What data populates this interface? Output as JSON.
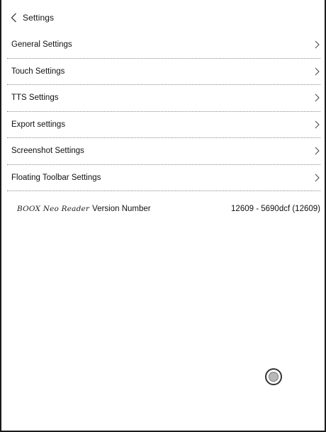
{
  "header": {
    "back_icon": "chevron-left-icon",
    "title": "Settings"
  },
  "settings": {
    "items": [
      {
        "label": "General Settings",
        "icon": "chevron-right-icon"
      },
      {
        "label": "Touch Settings",
        "icon": "chevron-right-icon"
      },
      {
        "label": "TTS Settings",
        "icon": "chevron-right-icon"
      },
      {
        "label": "Export settings",
        "icon": "chevron-right-icon"
      },
      {
        "label": "Screenshot Settings",
        "icon": "chevron-right-icon"
      },
      {
        "label": "Floating Toolbar Settings",
        "icon": "chevron-right-icon"
      }
    ]
  },
  "version": {
    "brand": "BOOX Neo Reader",
    "label": "Version Number",
    "value": "12609 - 5690dcf (12609)"
  },
  "floating_button": {
    "icon": "floating-toolbar-icon"
  }
}
